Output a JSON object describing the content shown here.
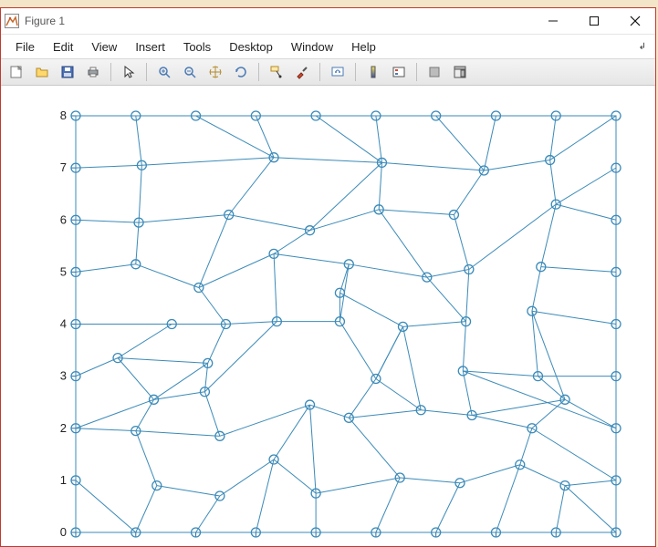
{
  "window": {
    "title": "Figure 1"
  },
  "menu": {
    "items": [
      "File",
      "Edit",
      "View",
      "Insert",
      "Tools",
      "Desktop",
      "Window",
      "Help"
    ]
  },
  "toolbar": {
    "icons": [
      "new-figure-icon",
      "open-icon",
      "save-icon",
      "print-icon",
      "SEP",
      "pointer-icon",
      "SEP",
      "zoom-in-icon",
      "zoom-out-icon",
      "pan-icon",
      "rotate-icon",
      "SEP",
      "data-cursor-icon",
      "brush-icon",
      "SEP",
      "link-plot-icon",
      "SEP",
      "insert-colorbar-icon",
      "insert-legend-icon",
      "SEP",
      "hide-tools-icon",
      "dock-icon"
    ]
  },
  "chart_data": {
    "type": "scatter",
    "title": "",
    "xlabel": "",
    "ylabel": "",
    "xlim": [
      0,
      9
    ],
    "ylim": [
      0,
      8
    ],
    "xticks": [
      0,
      1,
      2,
      3,
      4,
      5,
      6,
      7,
      8,
      9
    ],
    "yticks": [
      0,
      1,
      2,
      3,
      4,
      5,
      6,
      7,
      8
    ],
    "xticklabels": [
      "",
      "",
      "",
      "",
      "",
      "",
      "",
      "",
      "",
      ""
    ],
    "yticklabels": [
      "0",
      "1",
      "2",
      "3",
      "4",
      "5",
      "6",
      "7",
      "8"
    ],
    "nodes": [
      [
        0,
        0
      ],
      [
        1,
        0
      ],
      [
        2,
        0
      ],
      [
        3,
        0
      ],
      [
        4,
        0
      ],
      [
        5,
        0
      ],
      [
        6,
        0
      ],
      [
        7,
        0
      ],
      [
        8,
        0
      ],
      [
        9,
        0
      ],
      [
        9,
        1
      ],
      [
        9,
        2
      ],
      [
        9,
        3
      ],
      [
        9,
        4
      ],
      [
        9,
        5
      ],
      [
        9,
        6
      ],
      [
        9,
        7
      ],
      [
        9,
        8
      ],
      [
        8,
        8
      ],
      [
        7,
        8
      ],
      [
        6,
        8
      ],
      [
        5,
        8
      ],
      [
        4,
        8
      ],
      [
        3,
        8
      ],
      [
        2,
        8
      ],
      [
        1,
        8
      ],
      [
        0,
        8
      ],
      [
        0,
        7
      ],
      [
        0,
        6
      ],
      [
        0,
        5
      ],
      [
        0,
        4
      ],
      [
        0,
        3
      ],
      [
        0,
        2
      ],
      [
        0,
        1
      ],
      [
        1.1,
        7.05
      ],
      [
        3.3,
        7.2
      ],
      [
        5.1,
        7.1
      ],
      [
        6.8,
        6.95
      ],
      [
        7.9,
        7.15
      ],
      [
        1.05,
        5.95
      ],
      [
        2.55,
        6.1
      ],
      [
        3.9,
        5.8
      ],
      [
        5.05,
        6.2
      ],
      [
        6.3,
        6.1
      ],
      [
        8.0,
        6.3
      ],
      [
        1.0,
        5.15
      ],
      [
        2.05,
        4.7
      ],
      [
        3.3,
        5.35
      ],
      [
        4.55,
        5.15
      ],
      [
        5.85,
        4.9
      ],
      [
        6.55,
        5.05
      ],
      [
        7.75,
        5.1
      ],
      [
        1.6,
        4.0
      ],
      [
        2.5,
        4.0
      ],
      [
        4.4,
        4.6
      ],
      [
        6.5,
        4.05
      ],
      [
        7.6,
        4.25
      ],
      [
        0.7,
        3.35
      ],
      [
        2.2,
        3.25
      ],
      [
        3.35,
        4.05
      ],
      [
        4.4,
        4.05
      ],
      [
        5.45,
        3.95
      ],
      [
        6.45,
        3.1
      ],
      [
        7.7,
        3.0
      ],
      [
        1.3,
        2.55
      ],
      [
        2.15,
        2.7
      ],
      [
        3.9,
        2.45
      ],
      [
        5.0,
        2.95
      ],
      [
        5.75,
        2.35
      ],
      [
        6.6,
        2.25
      ],
      [
        8.15,
        2.55
      ],
      [
        1.0,
        1.95
      ],
      [
        2.4,
        1.85
      ],
      [
        4.55,
        2.2
      ],
      [
        7.6,
        2.0
      ],
      [
        1.35,
        0.9
      ],
      [
        2.4,
        0.7
      ],
      [
        3.3,
        1.4
      ],
      [
        4.0,
        0.75
      ],
      [
        5.4,
        1.05
      ],
      [
        6.4,
        0.95
      ],
      [
        7.4,
        1.3
      ],
      [
        8.15,
        0.9
      ]
    ],
    "edges": [
      [
        0,
        33
      ],
      [
        33,
        1
      ],
      [
        1,
        75
      ],
      [
        2,
        76
      ],
      [
        75,
        76
      ],
      [
        76,
        77
      ],
      [
        77,
        3
      ],
      [
        77,
        78
      ],
      [
        78,
        4
      ],
      [
        78,
        79
      ],
      [
        79,
        5
      ],
      [
        79,
        80
      ],
      [
        80,
        6
      ],
      [
        80,
        81
      ],
      [
        81,
        7
      ],
      [
        81,
        82
      ],
      [
        82,
        8
      ],
      [
        82,
        9
      ],
      [
        82,
        10
      ],
      [
        81,
        74
      ],
      [
        74,
        70
      ],
      [
        74,
        10
      ],
      [
        10,
        11
      ],
      [
        11,
        70
      ],
      [
        70,
        63
      ],
      [
        70,
        69
      ],
      [
        69,
        68
      ],
      [
        68,
        73
      ],
      [
        73,
        67
      ],
      [
        73,
        79
      ],
      [
        68,
        67
      ],
      [
        67,
        61
      ],
      [
        67,
        60
      ],
      [
        66,
        78
      ],
      [
        66,
        77
      ],
      [
        66,
        72
      ],
      [
        72,
        65
      ],
      [
        65,
        64
      ],
      [
        64,
        71
      ],
      [
        71,
        32
      ],
      [
        32,
        33
      ],
      [
        64,
        58
      ],
      [
        58,
        57
      ],
      [
        57,
        31
      ],
      [
        31,
        32
      ],
      [
        57,
        52
      ],
      [
        52,
        30
      ],
      [
        30,
        31
      ],
      [
        52,
        53
      ],
      [
        53,
        46
      ],
      [
        46,
        45
      ],
      [
        45,
        29
      ],
      [
        29,
        30
      ],
      [
        45,
        39
      ],
      [
        39,
        28
      ],
      [
        28,
        29
      ],
      [
        39,
        34
      ],
      [
        34,
        27
      ],
      [
        27,
        28
      ],
      [
        34,
        25
      ],
      [
        25,
        26
      ],
      [
        26,
        27
      ],
      [
        34,
        35
      ],
      [
        35,
        24
      ],
      [
        24,
        25
      ],
      [
        35,
        23
      ],
      [
        23,
        24
      ],
      [
        35,
        36
      ],
      [
        36,
        22
      ],
      [
        22,
        23
      ],
      [
        36,
        21
      ],
      [
        21,
        22
      ],
      [
        36,
        37
      ],
      [
        37,
        20
      ],
      [
        20,
        21
      ],
      [
        37,
        19
      ],
      [
        19,
        20
      ],
      [
        37,
        38
      ],
      [
        38,
        18
      ],
      [
        18,
        19
      ],
      [
        38,
        17
      ],
      [
        17,
        18
      ],
      [
        38,
        44
      ],
      [
        44,
        16
      ],
      [
        16,
        17
      ],
      [
        44,
        15
      ],
      [
        15,
        16
      ],
      [
        44,
        51
      ],
      [
        51,
        14
      ],
      [
        14,
        15
      ],
      [
        51,
        56
      ],
      [
        56,
        13
      ],
      [
        13,
        14
      ],
      [
        56,
        63
      ],
      [
        63,
        12
      ],
      [
        12,
        13
      ],
      [
        63,
        62
      ],
      [
        62,
        11
      ],
      [
        11,
        12
      ],
      [
        62,
        55
      ],
      [
        55,
        50
      ],
      [
        50,
        49
      ],
      [
        49,
        48
      ],
      [
        48,
        47
      ],
      [
        47,
        41
      ],
      [
        41,
        40
      ],
      [
        40,
        39
      ],
      [
        40,
        35
      ],
      [
        41,
        36
      ],
      [
        41,
        42
      ],
      [
        42,
        36
      ],
      [
        42,
        43
      ],
      [
        43,
        37
      ],
      [
        43,
        50
      ],
      [
        50,
        44
      ],
      [
        49,
        42
      ],
      [
        48,
        54
      ],
      [
        54,
        60
      ],
      [
        60,
        59
      ],
      [
        59,
        53
      ],
      [
        59,
        47
      ],
      [
        47,
        46
      ],
      [
        46,
        40
      ],
      [
        53,
        58
      ],
      [
        58,
        65
      ],
      [
        65,
        59
      ],
      [
        61,
        54
      ],
      [
        61,
        67
      ],
      [
        61,
        68
      ],
      [
        55,
        61
      ],
      [
        55,
        49
      ],
      [
        62,
        69
      ],
      [
        69,
        74
      ],
      [
        66,
        73
      ],
      [
        72,
        71
      ],
      [
        71,
        75
      ],
      [
        64,
        32
      ],
      [
        9,
        10
      ],
      [
        0,
        1
      ],
      [
        1,
        2
      ],
      [
        2,
        3
      ],
      [
        3,
        4
      ],
      [
        4,
        5
      ],
      [
        5,
        6
      ],
      [
        6,
        7
      ],
      [
        7,
        8
      ],
      [
        8,
        9
      ],
      [
        57,
        64
      ],
      [
        56,
        70
      ],
      [
        60,
        48
      ]
    ]
  }
}
